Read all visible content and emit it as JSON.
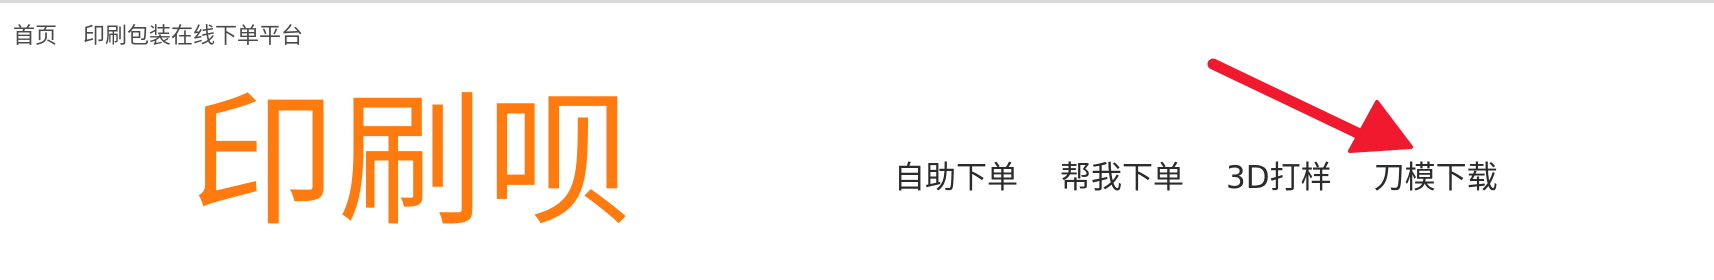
{
  "topbar": {
    "links": [
      "首页",
      "印刷包装在线下单平台"
    ]
  },
  "logo": {
    "text": "印刷呗"
  },
  "nav": {
    "items": [
      "自助下单",
      "帮我下单",
      "3D打样",
      "刀模下载"
    ]
  },
  "colors": {
    "brand": "#ff7a0f",
    "annotation_arrow": "#f0192e",
    "nav_text": "#2b2b2b",
    "topbar_text": "#4a4a4a"
  }
}
